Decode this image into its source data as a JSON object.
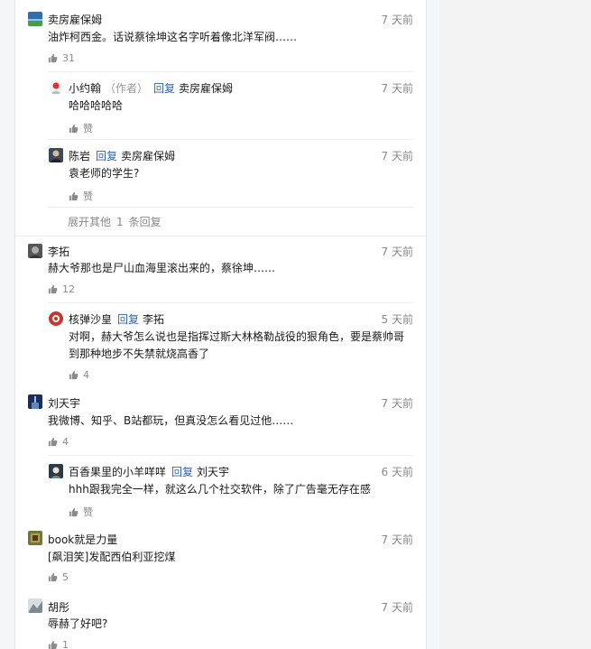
{
  "comments": [
    {
      "author": "卖房雇保姆",
      "time": "7 天前",
      "text": "油炸柯西金。话说蔡徐坤这名字听着像北洋军阀……",
      "likes": "31",
      "replies": [
        {
          "author": "小约翰",
          "role": "（作者）",
          "reply_word": "回复",
          "reply_to": "卖房雇保姆",
          "time": "7 天前",
          "text": "哈哈哈哈哈",
          "likes": "赞"
        },
        {
          "author": "陈岩",
          "reply_word": "回复",
          "reply_to": "卖房雇保姆",
          "time": "7 天前",
          "text": "袁老师的学生?",
          "likes": "赞"
        }
      ],
      "more": {
        "prefix": "展开其他",
        "count": "1",
        "suffix": "条回复"
      }
    },
    {
      "author": "李拓",
      "time": "7 天前",
      "text": "赫大爷那也是尸山血海里滚出来的，蔡徐坤……",
      "likes": "12",
      "replies": [
        {
          "author": "核弹沙皇",
          "reply_word": "回复",
          "reply_to": "李拓",
          "time": "5 天前",
          "text_line1": "对啊，赫大爷怎么说也是指挥过斯大林格勒战役的狠角色，要是蔡帅哥",
          "text_line2": "到那种地步不失禁就烧高香了",
          "likes": "4"
        }
      ]
    },
    {
      "author": "刘天宇",
      "time": "7 天前",
      "text": "我微博、知乎、B站都玩，但真没怎么看见过他……",
      "likes": "4",
      "replies": [
        {
          "author": "百香果里的小羊咩咩",
          "reply_word": "回复",
          "reply_to": "刘天宇",
          "time": "6 天前",
          "text": "hhh跟我完全一样，就这么几个社交软件，除了广告毫无存在感",
          "likes": "赞"
        }
      ]
    },
    {
      "author": "book就是力量",
      "time": "7 天前",
      "text": "[飙泪笑]发配西伯利亚挖煤",
      "likes": "5"
    },
    {
      "author": "胡彤",
      "time": "7 天前",
      "text": "辱赫了好吧?",
      "likes": "1"
    }
  ],
  "icons": {
    "like": "thumbs-up-icon"
  },
  "colors": {
    "link": "#2d64b3",
    "muted": "#888888",
    "like": "#8a8a8a"
  }
}
